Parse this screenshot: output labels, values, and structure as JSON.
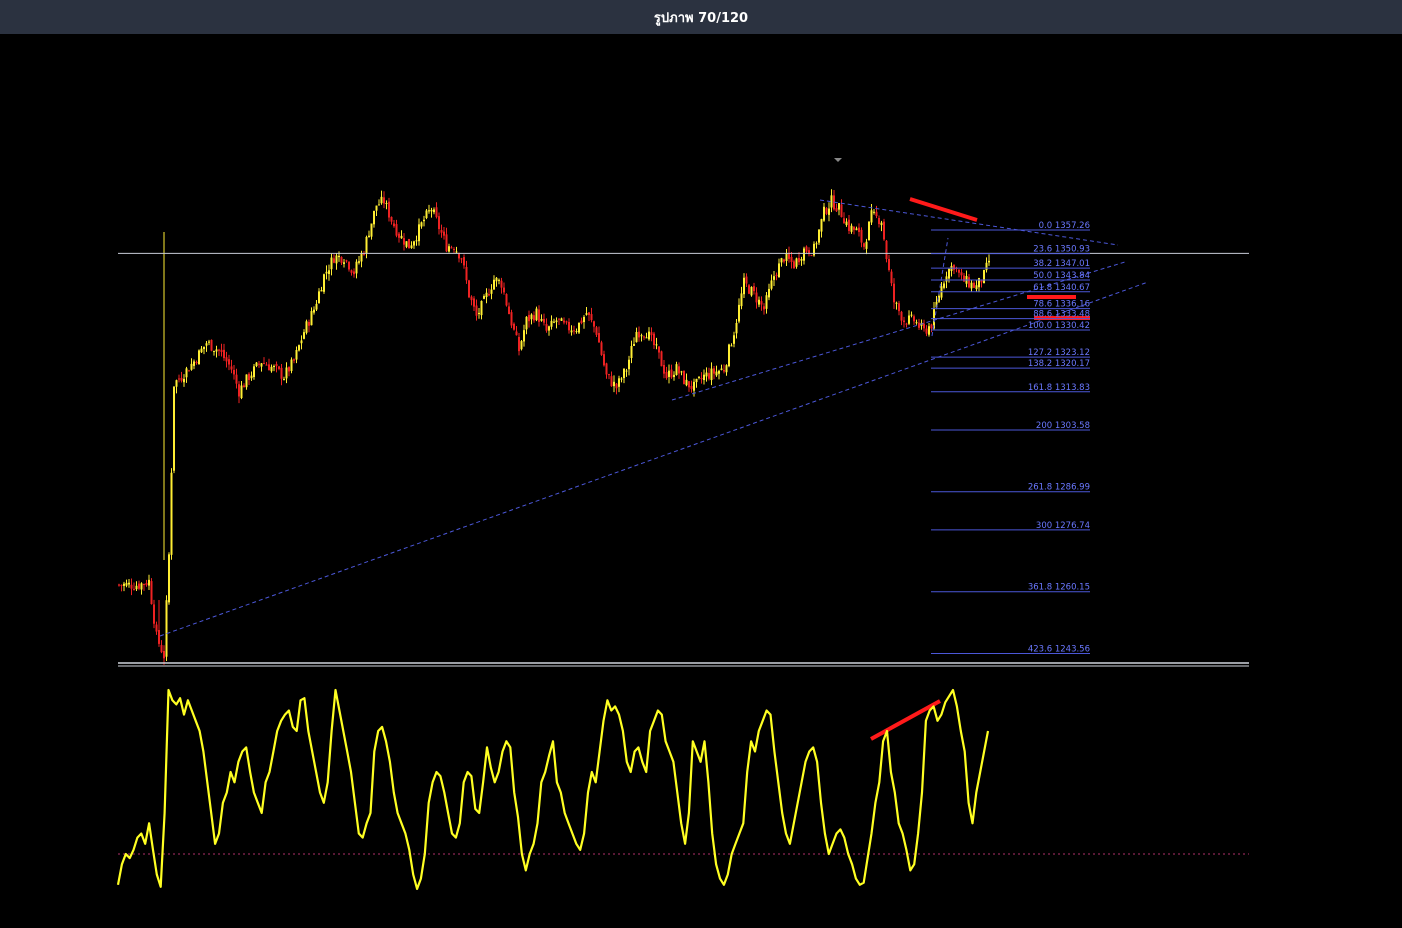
{
  "window": {
    "title": "รูปภาพ 70/120"
  },
  "chart_data": [
    {
      "type": "candlestick",
      "title": "",
      "xlabel": "",
      "ylabel": "",
      "ylim": [
        1240,
        1380
      ],
      "grid": false,
      "horizontal_line": 1351.0,
      "fibonacci": [
        {
          "level": "0.0",
          "price": 1357.26
        },
        {
          "level": "23.6",
          "price": 1350.93
        },
        {
          "level": "38.2",
          "price": 1347.01
        },
        {
          "level": "50.0",
          "price": 1343.84
        },
        {
          "level": "61.8",
          "price": 1340.67
        },
        {
          "level": "78.6",
          "price": 1336.16
        },
        {
          "level": "88.6",
          "price": 1333.48
        },
        {
          "level": "100.0",
          "price": 1330.42
        },
        {
          "level": "127.2",
          "price": 1323.12
        },
        {
          "level": "138.2",
          "price": 1320.17
        },
        {
          "level": "161.8",
          "price": 1313.83
        },
        {
          "level": "200",
          "price": 1303.58
        },
        {
          "level": "261.8",
          "price": 1286.99
        },
        {
          "level": "300",
          "price": 1276.74
        },
        {
          "level": "361.8",
          "price": 1260.15
        },
        {
          "level": "423.6",
          "price": 1243.56
        }
      ],
      "price_path": [
        [
          0,
          1262
        ],
        [
          8,
          1262
        ],
        [
          12,
          1263
        ],
        [
          15,
          1248
        ],
        [
          18,
          1243
        ],
        [
          20,
          1270
        ],
        [
          22,
          1316
        ],
        [
          25,
          1318
        ],
        [
          30,
          1322
        ],
        [
          35,
          1327
        ],
        [
          40,
          1325
        ],
        [
          45,
          1320
        ],
        [
          48,
          1314
        ],
        [
          52,
          1318
        ],
        [
          57,
          1322
        ],
        [
          62,
          1320
        ],
        [
          66,
          1318
        ],
        [
          70,
          1322
        ],
        [
          74,
          1330
        ],
        [
          78,
          1336
        ],
        [
          82,
          1345
        ],
        [
          86,
          1350
        ],
        [
          90,
          1350
        ],
        [
          94,
          1346
        ],
        [
          98,
          1352
        ],
        [
          100,
          1357
        ],
        [
          103,
          1364
        ],
        [
          106,
          1365
        ],
        [
          109,
          1360
        ],
        [
          112,
          1356
        ],
        [
          116,
          1353
        ],
        [
          119,
          1356
        ],
        [
          122,
          1360
        ],
        [
          125,
          1363
        ],
        [
          128,
          1358
        ],
        [
          131,
          1353
        ],
        [
          134,
          1353
        ],
        [
          137,
          1350
        ],
        [
          140,
          1340
        ],
        [
          143,
          1334
        ],
        [
          146,
          1338
        ],
        [
          150,
          1344
        ],
        [
          153,
          1343
        ],
        [
          156,
          1335
        ],
        [
          160,
          1325
        ],
        [
          163,
          1333
        ],
        [
          167,
          1335
        ],
        [
          171,
          1330
        ],
        [
          175,
          1333
        ],
        [
          179,
          1331
        ],
        [
          183,
          1331
        ],
        [
          187,
          1335
        ],
        [
          191,
          1330
        ],
        [
          195,
          1318
        ],
        [
          199,
          1315
        ],
        [
          203,
          1320
        ],
        [
          207,
          1330
        ],
        [
          211,
          1330
        ],
        [
          215,
          1325
        ],
        [
          219,
          1318
        ],
        [
          223,
          1320
        ],
        [
          227,
          1316
        ],
        [
          230,
          1315
        ],
        [
          234,
          1318
        ],
        [
          238,
          1319
        ],
        [
          242,
          1320
        ],
        [
          246,
          1330
        ],
        [
          250,
          1343
        ],
        [
          254,
          1340
        ],
        [
          258,
          1336
        ],
        [
          262,
          1345
        ],
        [
          266,
          1350
        ],
        [
          270,
          1348
        ],
        [
          274,
          1352
        ],
        [
          278,
          1352
        ],
        [
          282,
          1362
        ],
        [
          285,
          1365
        ],
        [
          288,
          1363
        ],
        [
          292,
          1358
        ],
        [
          295,
          1357
        ],
        [
          298,
          1353
        ],
        [
          301,
          1361
        ],
        [
          305,
          1360
        ],
        [
          307,
          1350
        ],
        [
          310,
          1338
        ],
        [
          314,
          1333
        ],
        [
          318,
          1333
        ],
        [
          322,
          1330
        ],
        [
          325,
          1332
        ],
        [
          328,
          1340
        ],
        [
          331,
          1346
        ],
        [
          334,
          1348
        ],
        [
          337,
          1344
        ],
        [
          340,
          1343
        ],
        [
          343,
          1342
        ],
        [
          346,
          1345
        ],
        [
          348,
          1349
        ]
      ]
    },
    {
      "type": "line",
      "title": "",
      "ylim": [
        0,
        100
      ],
      "reference_line": 20,
      "series": [
        {
          "values": [
            5,
            15,
            20,
            18,
            22,
            28,
            30,
            25,
            35,
            22,
            10,
            4,
            40,
            100,
            95,
            93,
            96,
            88,
            95,
            90,
            85,
            80,
            70,
            55,
            40,
            25,
            30,
            45,
            50,
            60,
            55,
            65,
            70,
            72,
            60,
            50,
            45,
            40,
            55,
            60,
            70,
            80,
            85,
            88,
            90,
            82,
            80,
            95,
            96,
            80,
            70,
            60,
            50,
            45,
            55,
            80,
            100,
            90,
            80,
            70,
            60,
            45,
            30,
            28,
            35,
            40,
            70,
            80,
            82,
            75,
            65,
            50,
            40,
            35,
            30,
            22,
            10,
            3,
            8,
            20,
            45,
            55,
            60,
            58,
            50,
            40,
            30,
            28,
            35,
            55,
            60,
            58,
            42,
            40,
            55,
            72,
            62,
            55,
            60,
            70,
            75,
            72,
            50,
            38,
            20,
            12,
            20,
            25,
            35,
            55,
            60,
            68,
            75,
            55,
            50,
            40,
            35,
            30,
            25,
            22,
            30,
            50,
            60,
            55,
            70,
            85,
            95,
            90,
            92,
            88,
            80,
            65,
            60,
            70,
            72,
            65,
            60,
            80,
            85,
            90,
            88,
            75,
            70,
            65,
            50,
            35,
            25,
            40,
            75,
            70,
            65,
            75,
            55,
            30,
            15,
            8,
            5,
            10,
            20,
            25,
            30,
            35,
            60,
            75,
            70,
            80,
            85,
            90,
            88,
            70,
            55,
            40,
            30,
            25,
            35,
            45,
            55,
            65,
            70,
            72,
            65,
            45,
            30,
            20,
            25,
            30,
            32,
            28,
            20,
            15,
            8,
            5,
            6,
            18,
            30,
            45,
            55,
            75,
            80,
            60,
            50,
            35,
            30,
            22,
            12,
            15,
            30,
            50,
            85,
            90,
            92,
            85,
            88,
            94,
            97,
            100,
            92,
            80,
            70,
            45,
            35,
            50,
            60,
            70,
            80
          ]
        }
      ]
    }
  ]
}
